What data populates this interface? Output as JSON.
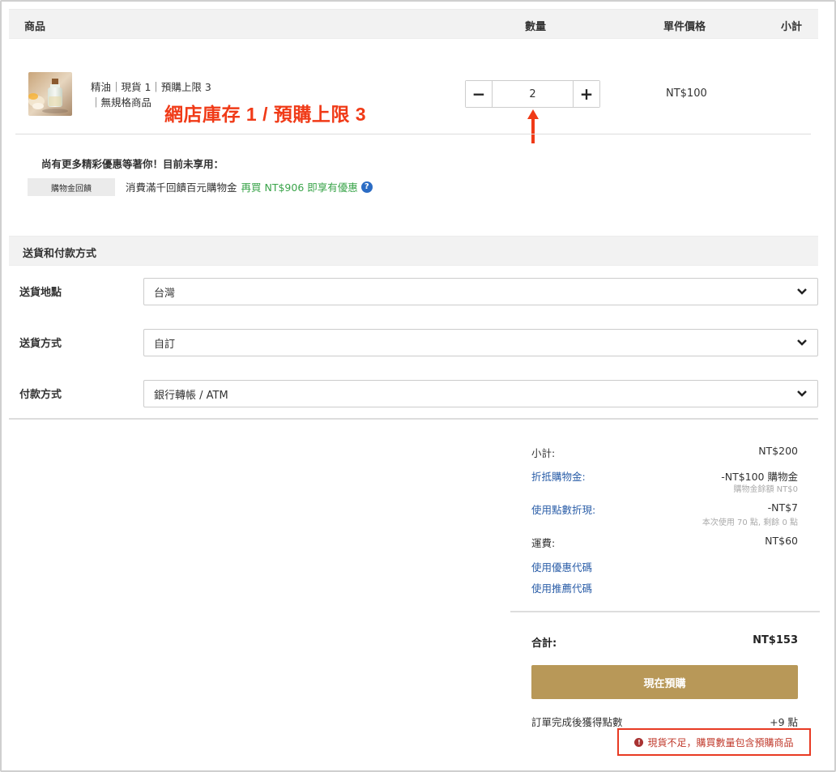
{
  "table_header": {
    "product": "商品",
    "quantity": "數量",
    "unit_price": "單件價格",
    "subtotal": "小計"
  },
  "item": {
    "name_line1": "精油｜現貨 1｜預購上限 3",
    "name_line2": "｜無規格商品",
    "quantity": "2",
    "decrement": "−",
    "increment": "+",
    "unit_price": "NT$100",
    "annotation": "網店庫存 1 / 預購上限 3"
  },
  "promo": {
    "title": "尚有更多精彩優惠等著你！目前未享用：",
    "tag": "購物金回饋",
    "description": "消費滿千回饋百元購物金",
    "highlight": "再買 NT$906 即享有優惠",
    "help_icon": "question-circle-icon"
  },
  "delivery": {
    "section_title": "送貨和付款方式",
    "location_label": "送貨地點",
    "location_value": "台灣",
    "method_label": "送貨方式",
    "method_value": "自訂",
    "payment_label": "付款方式",
    "payment_value": "銀行轉帳 / ATM"
  },
  "summary": {
    "subtotal_label": "小計:",
    "subtotal_value": "NT$200",
    "credit_label": "折抵購物金:",
    "credit_value": "-NT$100 購物金",
    "credit_note": "購物金餘額 NT$0",
    "points_label": "使用點數折現:",
    "points_value": "-NT$7",
    "points_note": "本次使用 70 點, 剩餘 0 點",
    "shipping_label": "運費:",
    "shipping_value": "NT$60",
    "coupon_link": "使用優惠代碼",
    "referral_link": "使用推薦代碼",
    "total_label": "合計:",
    "total_value": "NT$153",
    "checkout_button": "現在預購",
    "earn_points_label": "訂單完成後獲得點數",
    "earn_points_value": "+9 點",
    "warning": "現貨不足，購買數量包含預購商品"
  },
  "colors": {
    "accent_button": "#b89858",
    "link": "#2b5ea8",
    "promo_green": "#3aa44a",
    "annotation_red": "#f03a17",
    "warning_red": "#c0392b"
  }
}
